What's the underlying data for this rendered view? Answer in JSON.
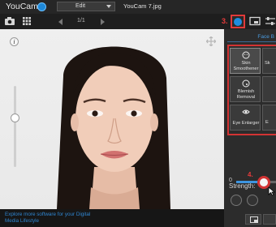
{
  "app": {
    "title": "YouCam"
  },
  "mode": {
    "selected": "Edit"
  },
  "file": {
    "name": "YouCam 7.jpg"
  },
  "pager": {
    "indicator": "1/1"
  },
  "annotations": {
    "step3": "3.",
    "step4": "4."
  },
  "panel": {
    "header": "Face B",
    "tools": [
      {
        "label": "Skin Smoothener",
        "icon": "face-smooth-icon",
        "selected": true
      },
      {
        "label": "Blemish Removal",
        "icon": "blemish-icon",
        "selected": false
      },
      {
        "label": "Eye Enlarger",
        "icon": "eye-icon",
        "selected": false
      }
    ],
    "ghost_labels": {
      "row1": "Sk",
      "row3": "E"
    }
  },
  "strength": {
    "label": "Strength:",
    "min": "0",
    "level_fraction": 0.7
  },
  "footer": {
    "promo_text": "Explore more software for your Digital Media Lifestyle"
  },
  "colors": {
    "accent": "#2f85d0",
    "highlight": "#d23333",
    "panel_bg": "#2c2c2c"
  }
}
